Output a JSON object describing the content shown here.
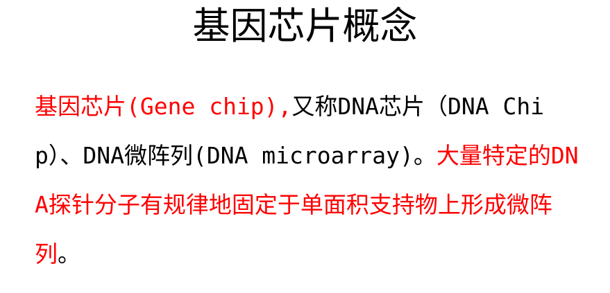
{
  "slide": {
    "title": "基因芯片概念",
    "paragraph": {
      "seg1": "基因芯片(Gene chip),",
      "seg2": "又称DNA芯片（DNA Chip）、DNA微阵列(DNA microarray)。",
      "seg3": "大量特定的DNA探针分子有规律地固定于单面积支持物上形成微阵列",
      "seg4": "。"
    }
  },
  "colors": {
    "highlight": "#ff0000",
    "text": "#000000",
    "background": "#ffffff"
  }
}
